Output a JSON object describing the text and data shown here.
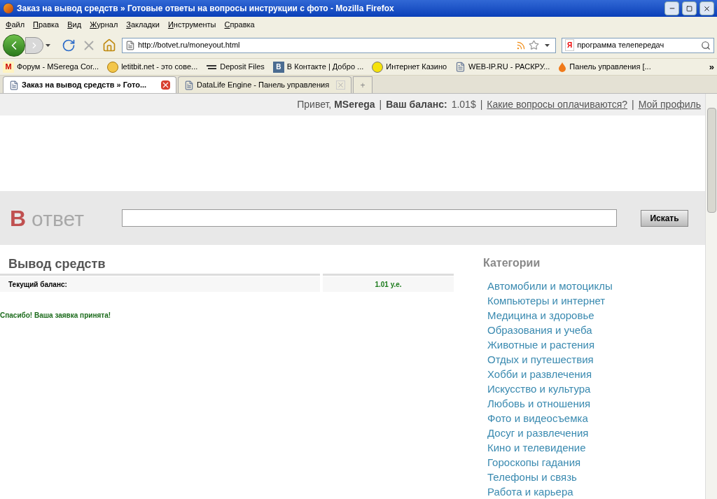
{
  "window": {
    "title": "Заказ на вывод средств » Готовые ответы на вопросы инструкции с фото - Mozilla Firefox"
  },
  "menu": [
    "Файл",
    "Правка",
    "Вид",
    "Журнал",
    "Закладки",
    "Инструменты",
    "Справка"
  ],
  "address": {
    "value": "http://botvet.ru/moneyout.html"
  },
  "search": {
    "value": "программа телепередач",
    "engine": "Я"
  },
  "bookmarks": [
    {
      "label": "Форум - MSerega Cor...",
      "kind": "gmail",
      "glyph": "M"
    },
    {
      "label": "letitbit.net - это сове...",
      "kind": "chat"
    },
    {
      "label": "Deposit Files",
      "kind": "deposit"
    },
    {
      "label": "В Контакте | Добро ...",
      "kind": "vk",
      "glyph": "B"
    },
    {
      "label": "Интернет Казино",
      "kind": "coin"
    },
    {
      "label": "WEB-IP.RU - РАСКРУ...",
      "kind": "page"
    },
    {
      "label": "Панель управления [...",
      "kind": "flame"
    }
  ],
  "bookmarks_more": "»",
  "tabs": [
    {
      "label": "Заказ на вывод средств » Гото...",
      "selected": true
    },
    {
      "label": "DataLife Engine - Панель управления",
      "selected": false
    }
  ],
  "tab_new": "+",
  "topbar": {
    "greeting": "Привет,",
    "user": "MSerega",
    "sep1": "|",
    "balance_label": "Ваш баланс:",
    "balance": "1.01$",
    "sep2": "|",
    "link1": "Какие вопросы оплачиваются?",
    "sep3": "|",
    "link2": "Мой профиль"
  },
  "logo": {
    "letter": "В",
    "word": "ответ"
  },
  "site_search": {
    "button": "Искать"
  },
  "withdraw": {
    "title": "Вывод средств",
    "rows": [
      {
        "label": "Текущий баланс:",
        "value": "1.01 у.е."
      }
    ],
    "message": "Спасибо! Ваша заявка принята!"
  },
  "categories": {
    "title": "Категории",
    "items": [
      "Автомобили и мотоциклы",
      "Компьютеры и интернет",
      "Медицина и здоровье",
      "Образования и учеба",
      "Животные и растения",
      "Отдых и путешествия",
      "Хобби и развлечения",
      "Искусство и культура",
      "Любовь и отношения",
      "Фото и видеосъемка",
      "Досуг и развлечения",
      "Кино и телевидение",
      "Гороскопы гадания",
      "Телефоны и связь",
      "Работа и карьера"
    ]
  }
}
